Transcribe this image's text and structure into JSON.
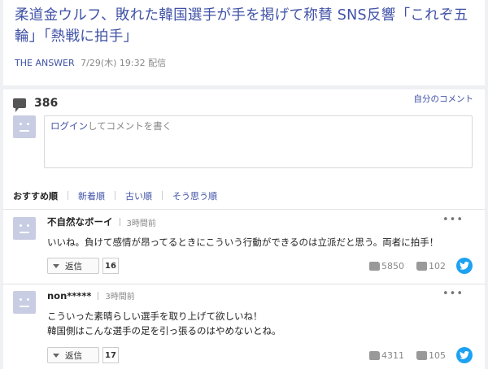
{
  "article": {
    "headline": "柔道金ウルフ、敗れた韓国選手が手を掲げて称賛 SNS反響「これぞ五輪」「熱戦に拍手」",
    "source": "THE ANSWER",
    "datetime": "7/29(木) 19:32 配信"
  },
  "comments_section": {
    "count": "386",
    "my_comments_label": "自分のコメント",
    "login_link": "ログイン",
    "login_prompt_rest": "してコメントを書く",
    "sort_tabs": [
      "おすすめ順",
      "新着順",
      "古い順",
      "そう思う順"
    ],
    "comments": [
      {
        "name": "不自然なボーイ",
        "time": "3時間前",
        "text_lines": [
          "いいね。負けて感情が昂ってるときにこういう行動ができるのは立派だと思う。両者に拍手！"
        ],
        "reply_label": "返信",
        "reply_count": "16",
        "likes": "5850",
        "dislikes": "102",
        "more": "•••"
      },
      {
        "name": "non*****",
        "time": "3時間前",
        "text_lines": [
          "こういった素晴らしい選手を取り上げて欲しいね！",
          "韓国側はこんな選手の足を引っ張るのはやめないとね。"
        ],
        "reply_label": "返信",
        "reply_count": "17",
        "likes": "4311",
        "dislikes": "105",
        "more": "•••"
      }
    ]
  },
  "colors": {
    "link": "#3f51a6",
    "twitter": "#1da1f2",
    "background": "#eef0f3"
  }
}
